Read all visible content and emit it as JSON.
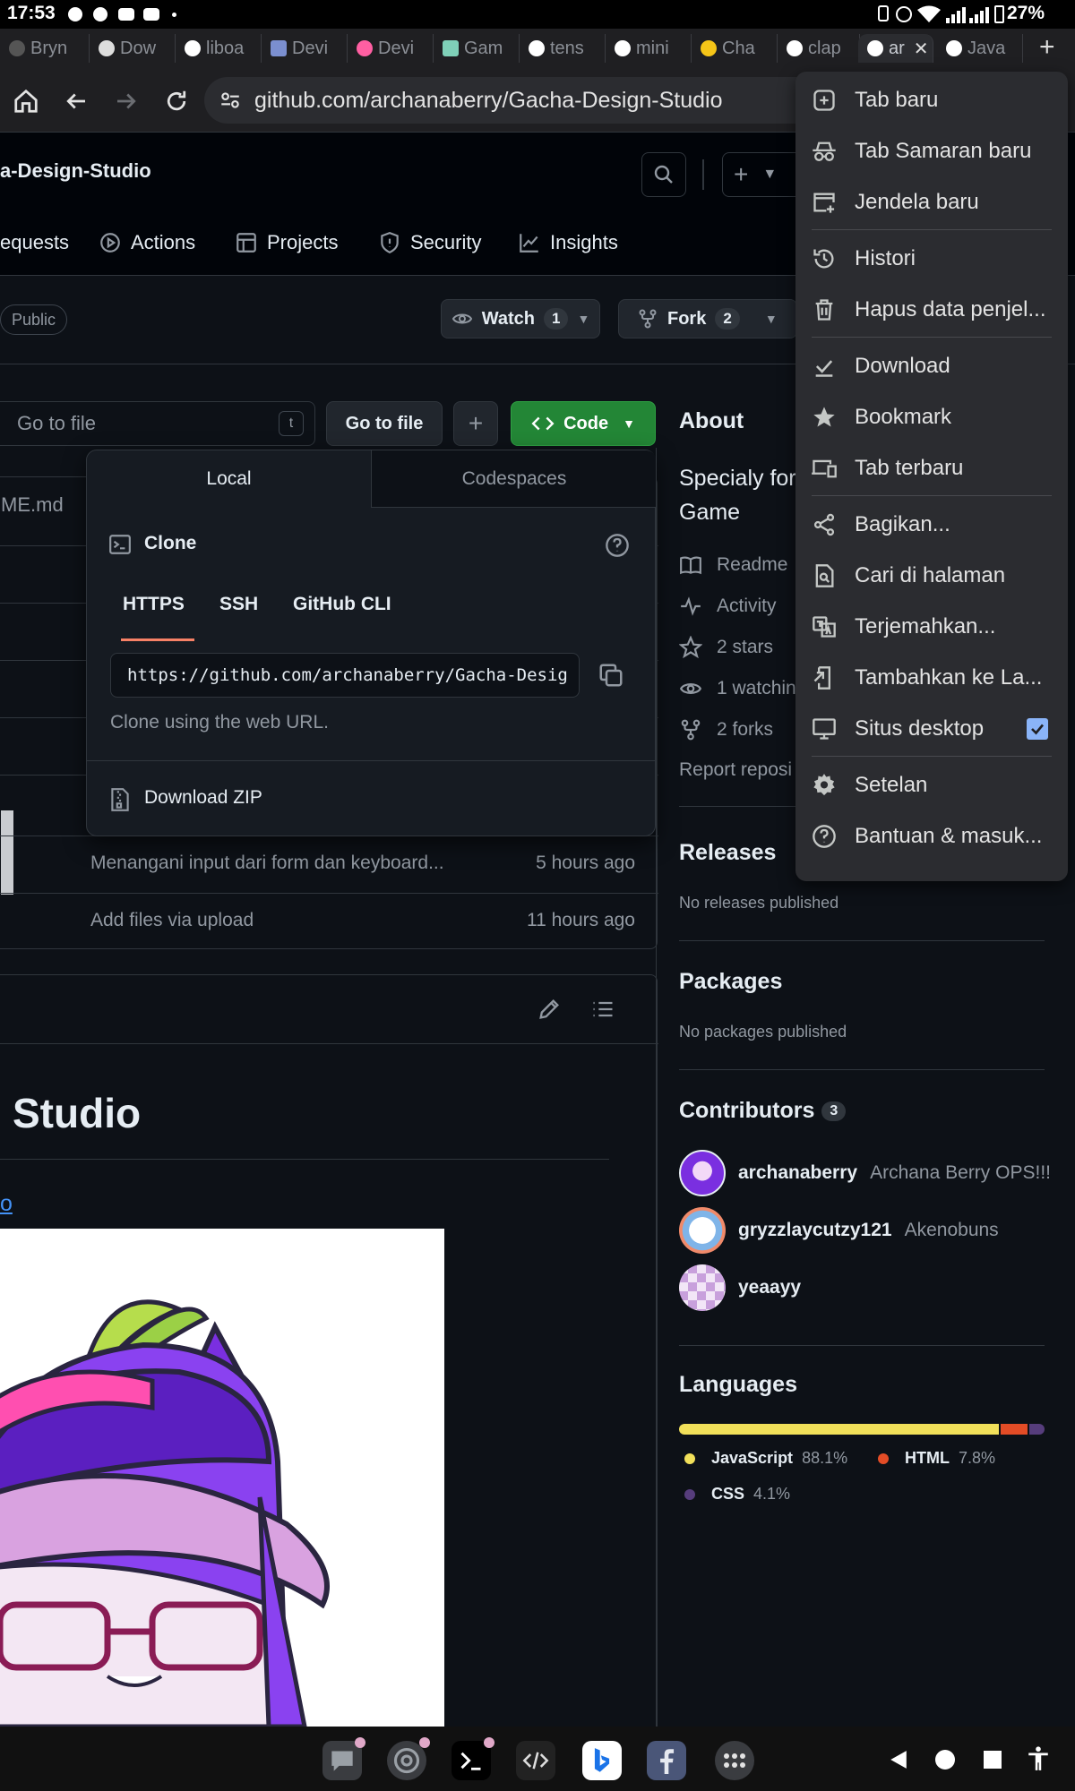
{
  "status_bar": {
    "time": "17:53",
    "battery": "27%"
  },
  "tabs": [
    "Bryn",
    "Dow",
    "liboa",
    "Devi",
    "Devi",
    "Gam",
    "tens",
    "mini",
    "Cha",
    "clap",
    "ar",
    "Java"
  ],
  "address_bar": {
    "url": "github.com/archanaberry/Gacha-Design-Studio"
  },
  "repo": {
    "name": "a-Design-Studio",
    "visibility": "Public",
    "nav": [
      "equests",
      "Actions",
      "Projects",
      "Security",
      "Insights"
    ],
    "watch_label": "Watch",
    "watch_count": "1",
    "fork_label": "Fork",
    "fork_count": "2"
  },
  "file_toolbar": {
    "search_placeholder": "Go to file",
    "shortcut": "t",
    "goto_label": "Go to file",
    "code_label": "Code"
  },
  "files": {
    "first": "ME.md",
    "rows": [
      {
        "message": "Menangani input dari form dan keyboard...",
        "time": "5 hours ago"
      },
      {
        "message": "Add files via upload",
        "time": "11 hours ago"
      }
    ]
  },
  "clone": {
    "tab_local": "Local",
    "tab_codespaces": "Codespaces",
    "title": "Clone",
    "protocols": [
      "HTTPS",
      "SSH",
      "GitHub CLI"
    ],
    "url": "https://github.com/archanaberry/Gacha-Desig",
    "hint": "Clone using the web URL.",
    "download_zip": "Download ZIP"
  },
  "readme": {
    "title": "Studio",
    "link": "o"
  },
  "about": {
    "title": "About",
    "description_line1": "Specialy for",
    "description_line2": "Game",
    "stats": [
      "Readme",
      "Activity",
      "2 stars",
      "1 watchin",
      "2 forks"
    ],
    "report": "Report reposi"
  },
  "releases": {
    "title": "Releases",
    "empty": "No releases published"
  },
  "packages": {
    "title": "Packages",
    "empty": "No packages published"
  },
  "contributors": {
    "title": "Contributors",
    "count": "3",
    "list": [
      {
        "login": "archanaberry",
        "name": "Archana Berry OPS!!!"
      },
      {
        "login": "gryzzlaycutzy121",
        "name": "Akenobuns"
      },
      {
        "login": "yeaayy",
        "name": ""
      }
    ]
  },
  "languages": {
    "title": "Languages",
    "items": [
      {
        "name": "JavaScript",
        "percent": "88.1%",
        "value": 88.1,
        "color": "#f1e05a"
      },
      {
        "name": "HTML",
        "percent": "7.8%",
        "value": 7.8,
        "color": "#e34c26"
      },
      {
        "name": "CSS",
        "percent": "4.1%",
        "value": 4.1,
        "color": "#563d7c"
      }
    ]
  },
  "menu": {
    "items": [
      "Tab baru",
      "Tab Samaran baru",
      "Jendela baru",
      "Histori",
      "Hapus data penjel...",
      "Download",
      "Bookmark",
      "Tab terbaru",
      "Bagikan...",
      "Cari di halaman",
      "Terjemahkan...",
      "Tambahkan ke La...",
      "Situs desktop",
      "Setelan",
      "Bantuan & masuk..."
    ],
    "desktop_site_checked": true
  },
  "colors": {
    "accent_green": "#238636",
    "link_blue": "#4493f8",
    "menu_check": "#8ab4f8"
  }
}
